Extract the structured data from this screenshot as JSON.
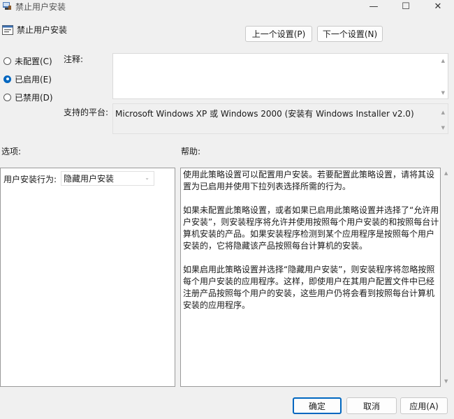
{
  "window": {
    "title": "禁止用户安装"
  },
  "header": {
    "title": "禁止用户安装",
    "prev_label": "上一个设置(P)",
    "next_label": "下一个设置(N)"
  },
  "state": {
    "options": [
      {
        "label": "未配置(C)",
        "checked": false
      },
      {
        "label": "已启用(E)",
        "checked": true
      },
      {
        "label": "已禁用(D)",
        "checked": false
      }
    ]
  },
  "comment": {
    "label": "注释:",
    "value": ""
  },
  "platform": {
    "label": "支持的平台:",
    "value": "Microsoft Windows XP 或 Windows 2000 (安装有 Windows Installer v2.0)"
  },
  "options_section": {
    "label": "选项:",
    "behavior_label": "用户安装行为:",
    "behavior_value": "隐藏用户安装"
  },
  "help_section": {
    "label": "帮助:",
    "paragraphs": [
      "使用此策略设置可以配置用户安装。若要配置此策略设置，请将其设置为已启用并使用下拉列表选择所需的行为。",
      "如果未配置此策略设置，或者如果已启用此策略设置并选择了“允许用户安装”，则安装程序将允许并使用按照每个用户安装的和按照每台计算机安装的产品。如果安装程序检测到某个应用程序是按照每个用户安装的，它将隐藏该产品按照每台计算机的安装。",
      "如果启用此策略设置并选择“隐藏用户安装”，则安装程序将忽略按照每个用户安装的应用程序。这样，即使用户在其用户配置文件中已经注册产品按照每个用户的安装，这些用户仍将会看到按照每台计算机安装的应用程序。"
    ]
  },
  "footer": {
    "ok_label": "确定",
    "cancel_label": "取消",
    "apply_label": "应用(A)"
  },
  "icons": {
    "window_controls": [
      "minimize-icon",
      "maximize-icon",
      "close-icon"
    ]
  },
  "colors": {
    "accent": "#0067c0",
    "background": "#f0f0f0"
  }
}
